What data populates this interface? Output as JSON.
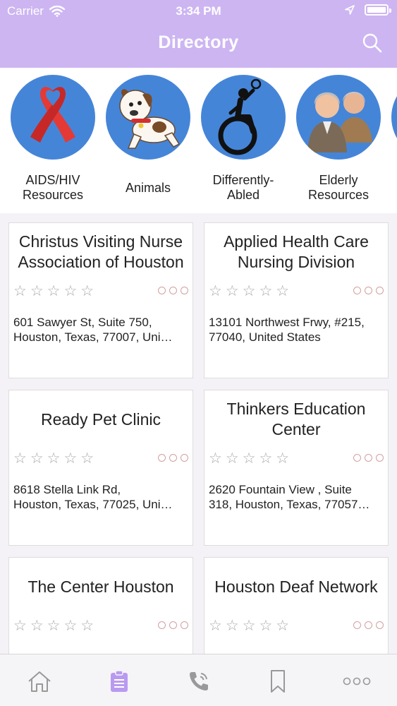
{
  "status_bar": {
    "carrier": "Carrier",
    "time": "3:34 PM"
  },
  "header": {
    "title": "Directory"
  },
  "categories": [
    {
      "label": "AIDS/HIV Resources",
      "icon": "red-ribbon-icon"
    },
    {
      "label": "Animals",
      "icon": "puppy-icon"
    },
    {
      "label": "Differently-Abled",
      "icon": "wheelchair-icon"
    },
    {
      "label": "Elderly Resources",
      "icon": "elderly-couple-icon"
    }
  ],
  "listings": [
    {
      "name": "Christus Visiting Nurse Association of Houston",
      "rating": 0,
      "stars": "☆☆☆☆☆",
      "address_line1": "601 Sawyer St, Suite 750,",
      "address_line2": "Houston, Texas, 77007, Uni…"
    },
    {
      "name": "Applied Health Care Nursing Division",
      "rating": 0,
      "stars": "☆☆☆☆☆",
      "address_line1": "13101 Northwest Frwy, #215,",
      "address_line2": "77040, United States"
    },
    {
      "name": "Ready Pet Clinic",
      "rating": 0,
      "stars": "☆☆☆☆☆",
      "address_line1": "8618 Stella Link Rd,",
      "address_line2": "Houston, Texas, 77025, Uni…"
    },
    {
      "name": "Thinkers Education Center",
      "rating": 0,
      "stars": "☆☆☆☆☆",
      "address_line1": "2620 Fountain View , Suite",
      "address_line2": "318, Houston, Texas, 77057…"
    },
    {
      "name": "The Center Houston",
      "rating": 0,
      "stars": "☆☆☆☆☆",
      "address_line1": "",
      "address_line2": ""
    },
    {
      "name": "Houston Deaf Network",
      "rating": 0,
      "stars": "☆☆☆☆☆",
      "address_line1": "",
      "address_line2": ""
    }
  ],
  "tab_bar": {
    "active_tab": "directory",
    "tabs": [
      "home-icon",
      "clipboard-icon",
      "phone-icon",
      "bookmark-icon",
      "more-icon"
    ]
  },
  "colors": {
    "header": "#cdb5f2",
    "category_circle": "#4585d8",
    "active_tab": "#b99af0"
  }
}
